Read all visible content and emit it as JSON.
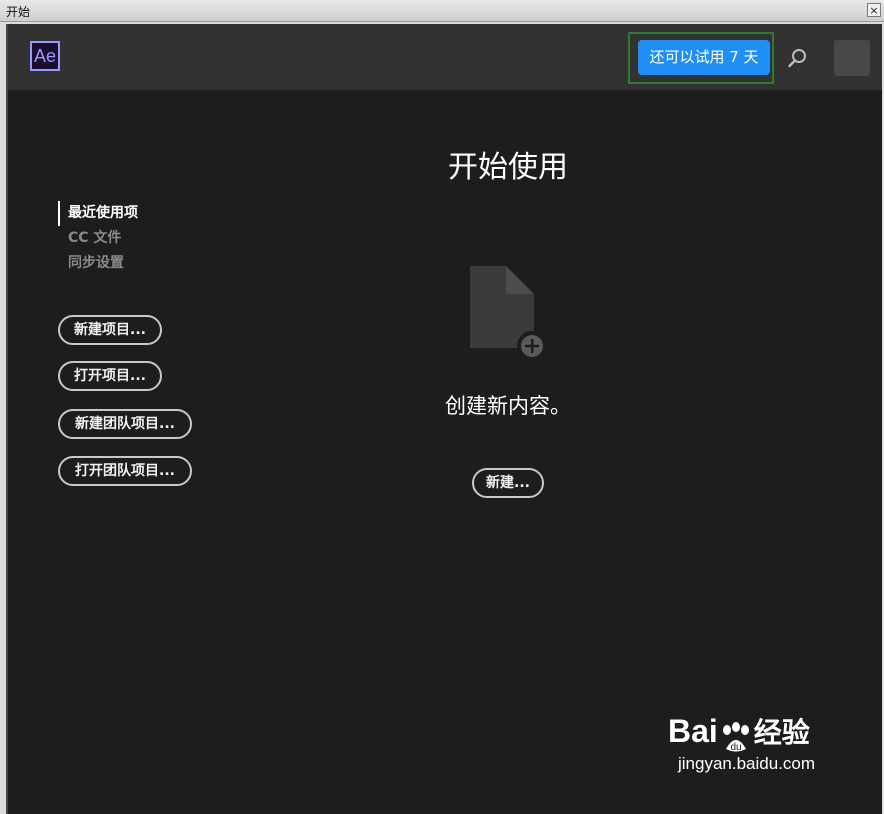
{
  "window": {
    "title": "开始",
    "close_glyph": "×"
  },
  "app": {
    "logo_text": "Ae",
    "trial_button": "还可以试用 7 天",
    "icons": {
      "search": "search-icon",
      "avatar": "avatar"
    }
  },
  "sidebar": {
    "items": [
      {
        "label": "最近使用项",
        "active": true
      },
      {
        "label": "CC 文件",
        "active": false
      },
      {
        "label": "同步设置",
        "active": false
      }
    ],
    "buttons": {
      "new_project": "新建项目...",
      "open_project": "打开项目...",
      "new_team_project": "新建团队项目...",
      "open_team_project": "打开团队项目..."
    }
  },
  "main": {
    "heading": "开始使用",
    "create_text": "创建新内容。",
    "new_button": "新建..."
  },
  "watermark": {
    "brand": "Bai",
    "brand_suffix": "经验",
    "url": "jingyan.baidu.com"
  },
  "colors": {
    "accent": "#1f8ff5",
    "ae_logo": "#9999ff",
    "background": "#1d1d1d",
    "topbar": "#323232"
  }
}
